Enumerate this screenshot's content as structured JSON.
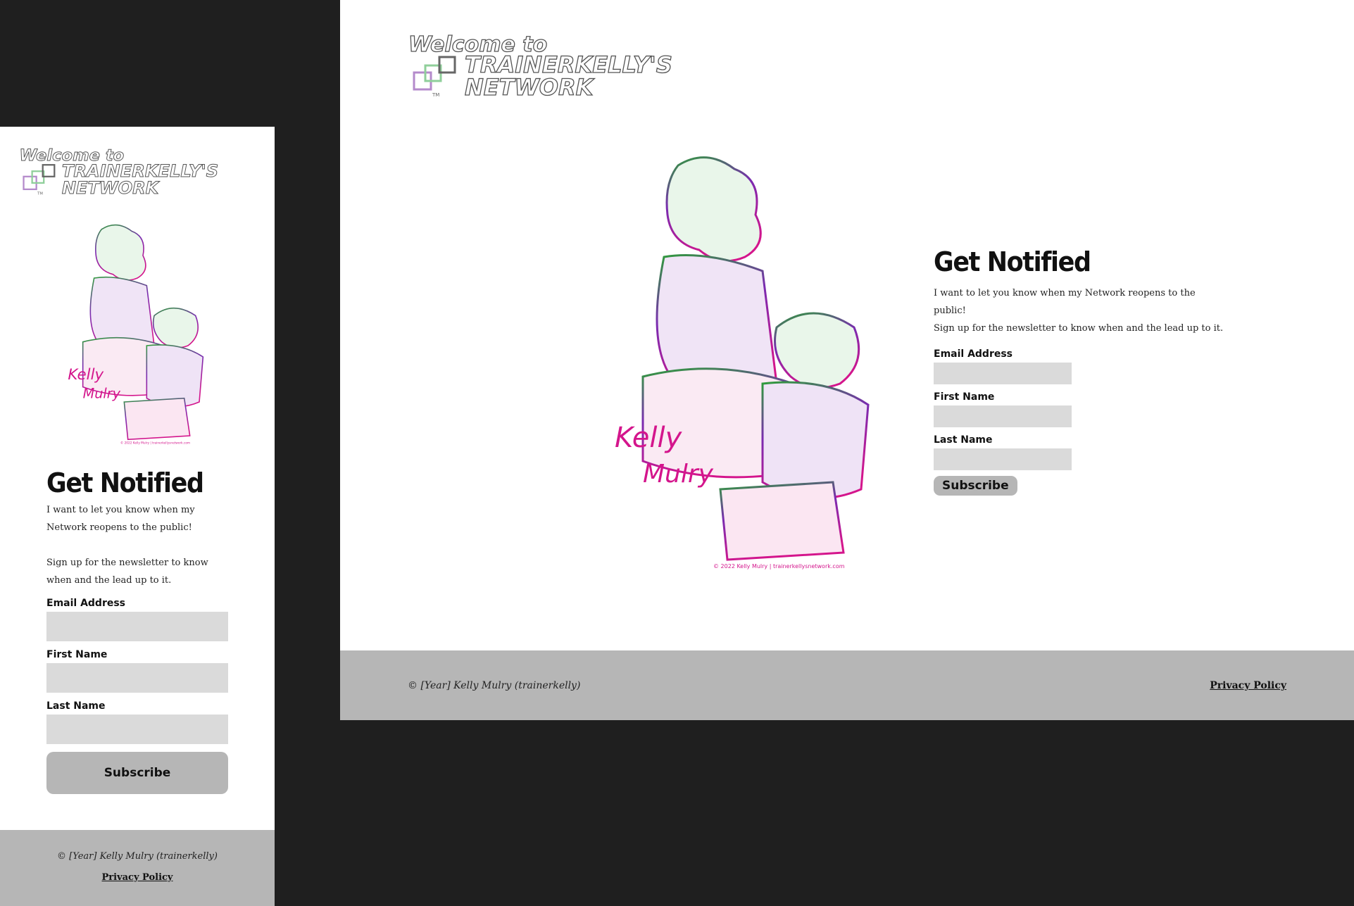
{
  "logo": {
    "line1": "Welcome to",
    "line2": "TRAINERKELLY'S",
    "line3": "NETWORK",
    "tm": "TM"
  },
  "signup": {
    "heading": "Get Notified",
    "intro_line1": "I want to let you know when my Network reopens to the public!",
    "intro_line2": "Sign up for the newsletter to know when and the lead up to it.",
    "email_label": "Email Address",
    "first_name_label": "First Name",
    "last_name_label": "Last Name",
    "subscribe_label": "Subscribe"
  },
  "artwork": {
    "signature_line1": "Kelly",
    "signature_line2": "Mulry",
    "credit": "© 2022 Kelly Mulry | trainerkellysnetwork.com"
  },
  "footer": {
    "copyright": "© [Year] Kelly Mulry (trainerkelly)",
    "privacy_link": "Privacy Policy"
  },
  "colors": {
    "backdrop": "#1f1f1f",
    "footer_bg": "#b6b6b6",
    "input_bg": "#dadada",
    "art_green": "#2e9d3a",
    "art_purple": "#7a2bb0",
    "art_magenta": "#d4158c"
  }
}
